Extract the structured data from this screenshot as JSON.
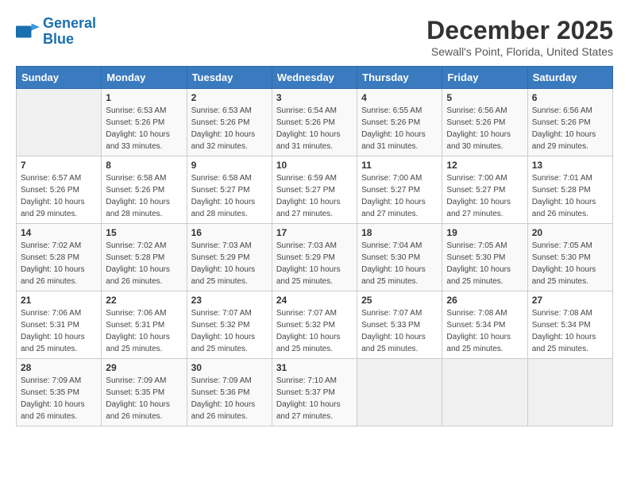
{
  "header": {
    "logo_line1": "General",
    "logo_line2": "Blue",
    "title": "December 2025",
    "subtitle": "Sewall's Point, Florida, United States"
  },
  "weekdays": [
    "Sunday",
    "Monday",
    "Tuesday",
    "Wednesday",
    "Thursday",
    "Friday",
    "Saturday"
  ],
  "weeks": [
    [
      {
        "day": "",
        "info": ""
      },
      {
        "day": "1",
        "info": "Sunrise: 6:53 AM\nSunset: 5:26 PM\nDaylight: 10 hours\nand 33 minutes."
      },
      {
        "day": "2",
        "info": "Sunrise: 6:53 AM\nSunset: 5:26 PM\nDaylight: 10 hours\nand 32 minutes."
      },
      {
        "day": "3",
        "info": "Sunrise: 6:54 AM\nSunset: 5:26 PM\nDaylight: 10 hours\nand 31 minutes."
      },
      {
        "day": "4",
        "info": "Sunrise: 6:55 AM\nSunset: 5:26 PM\nDaylight: 10 hours\nand 31 minutes."
      },
      {
        "day": "5",
        "info": "Sunrise: 6:56 AM\nSunset: 5:26 PM\nDaylight: 10 hours\nand 30 minutes."
      },
      {
        "day": "6",
        "info": "Sunrise: 6:56 AM\nSunset: 5:26 PM\nDaylight: 10 hours\nand 29 minutes."
      }
    ],
    [
      {
        "day": "7",
        "info": "Sunrise: 6:57 AM\nSunset: 5:26 PM\nDaylight: 10 hours\nand 29 minutes."
      },
      {
        "day": "8",
        "info": "Sunrise: 6:58 AM\nSunset: 5:26 PM\nDaylight: 10 hours\nand 28 minutes."
      },
      {
        "day": "9",
        "info": "Sunrise: 6:58 AM\nSunset: 5:27 PM\nDaylight: 10 hours\nand 28 minutes."
      },
      {
        "day": "10",
        "info": "Sunrise: 6:59 AM\nSunset: 5:27 PM\nDaylight: 10 hours\nand 27 minutes."
      },
      {
        "day": "11",
        "info": "Sunrise: 7:00 AM\nSunset: 5:27 PM\nDaylight: 10 hours\nand 27 minutes."
      },
      {
        "day": "12",
        "info": "Sunrise: 7:00 AM\nSunset: 5:27 PM\nDaylight: 10 hours\nand 27 minutes."
      },
      {
        "day": "13",
        "info": "Sunrise: 7:01 AM\nSunset: 5:28 PM\nDaylight: 10 hours\nand 26 minutes."
      }
    ],
    [
      {
        "day": "14",
        "info": "Sunrise: 7:02 AM\nSunset: 5:28 PM\nDaylight: 10 hours\nand 26 minutes."
      },
      {
        "day": "15",
        "info": "Sunrise: 7:02 AM\nSunset: 5:28 PM\nDaylight: 10 hours\nand 26 minutes."
      },
      {
        "day": "16",
        "info": "Sunrise: 7:03 AM\nSunset: 5:29 PM\nDaylight: 10 hours\nand 25 minutes."
      },
      {
        "day": "17",
        "info": "Sunrise: 7:03 AM\nSunset: 5:29 PM\nDaylight: 10 hours\nand 25 minutes."
      },
      {
        "day": "18",
        "info": "Sunrise: 7:04 AM\nSunset: 5:30 PM\nDaylight: 10 hours\nand 25 minutes."
      },
      {
        "day": "19",
        "info": "Sunrise: 7:05 AM\nSunset: 5:30 PM\nDaylight: 10 hours\nand 25 minutes."
      },
      {
        "day": "20",
        "info": "Sunrise: 7:05 AM\nSunset: 5:30 PM\nDaylight: 10 hours\nand 25 minutes."
      }
    ],
    [
      {
        "day": "21",
        "info": "Sunrise: 7:06 AM\nSunset: 5:31 PM\nDaylight: 10 hours\nand 25 minutes."
      },
      {
        "day": "22",
        "info": "Sunrise: 7:06 AM\nSunset: 5:31 PM\nDaylight: 10 hours\nand 25 minutes."
      },
      {
        "day": "23",
        "info": "Sunrise: 7:07 AM\nSunset: 5:32 PM\nDaylight: 10 hours\nand 25 minutes."
      },
      {
        "day": "24",
        "info": "Sunrise: 7:07 AM\nSunset: 5:32 PM\nDaylight: 10 hours\nand 25 minutes."
      },
      {
        "day": "25",
        "info": "Sunrise: 7:07 AM\nSunset: 5:33 PM\nDaylight: 10 hours\nand 25 minutes."
      },
      {
        "day": "26",
        "info": "Sunrise: 7:08 AM\nSunset: 5:34 PM\nDaylight: 10 hours\nand 25 minutes."
      },
      {
        "day": "27",
        "info": "Sunrise: 7:08 AM\nSunset: 5:34 PM\nDaylight: 10 hours\nand 25 minutes."
      }
    ],
    [
      {
        "day": "28",
        "info": "Sunrise: 7:09 AM\nSunset: 5:35 PM\nDaylight: 10 hours\nand 26 minutes."
      },
      {
        "day": "29",
        "info": "Sunrise: 7:09 AM\nSunset: 5:35 PM\nDaylight: 10 hours\nand 26 minutes."
      },
      {
        "day": "30",
        "info": "Sunrise: 7:09 AM\nSunset: 5:36 PM\nDaylight: 10 hours\nand 26 minutes."
      },
      {
        "day": "31",
        "info": "Sunrise: 7:10 AM\nSunset: 5:37 PM\nDaylight: 10 hours\nand 27 minutes."
      },
      {
        "day": "",
        "info": ""
      },
      {
        "day": "",
        "info": ""
      },
      {
        "day": "",
        "info": ""
      }
    ]
  ]
}
